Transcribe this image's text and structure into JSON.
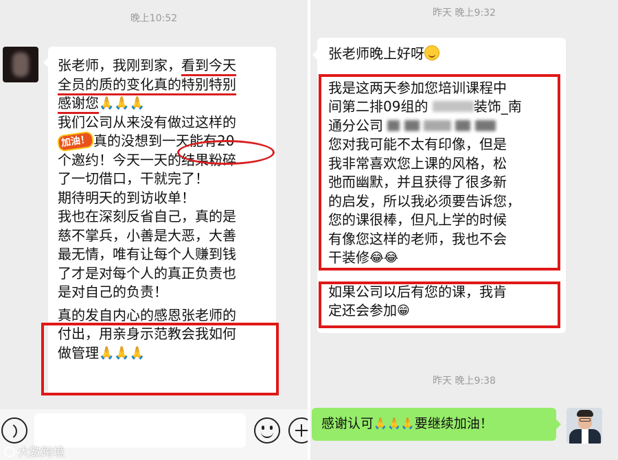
{
  "left_chat": {
    "timestamp": "晚上10:52",
    "message_lines": [
      "张老师，我刚到家，",
      "看到今天",
      "全员的质的变化真的",
      "特别特别",
      "感谢您",
      "我们公司从来没有做过这样的",
      "真的没想到",
      "一天能有20",
      "个邀约！今天一天的结果粉碎",
      "了一切借口，干就完了！",
      "期待明天的到访收单！",
      "我也在深刻反省自己，真的是",
      "慈不掌兵，小善是大恶，大善",
      "最无情，唯有让每个人赚到钱",
      "了才是对每个人的真正负责也",
      "是对自己的负责！",
      "真的发自内心的感恩张老师的",
      "付出，用亲身示范教会我如何",
      "做管理"
    ],
    "sticker_label": "加油！",
    "pray_emoji": "🙏🙏🙏",
    "input_placeholder": "",
    "watermark": "大數跨境"
  },
  "right_chat": {
    "timestamp_top": "昨天 晚上9:32",
    "greeting": "张老师晚上好呀",
    "message_lines": [
      "我是这两天参加您培训课程中",
      "间第二排09组的",
      "装饰_南",
      "通分公司",
      "您对我可能不太有印像，但是",
      "我非常喜欢您上课的风格，松",
      "弛而幽默，并且获得了很多新",
      "的启发，所以我必须要告诉您，",
      "您的课很棒，但凡上学的时候",
      "有像您这样的老师，我也不会",
      "干装修"
    ],
    "laugh_emoji": "😂😂",
    "followup_lines": [
      "如果公司以后有您的课，我肯",
      "定还会参加"
    ],
    "grin_emoji": "😁",
    "timestamp_bottom": "昨天 晚上9:38",
    "sent_message_prefix": "感谢认可",
    "sent_message_suffix": "要继续加油！",
    "sent_emoji": "🙏🙏🙏"
  },
  "colors": {
    "chat_background": "#ededed",
    "incoming_bubble": "#ffffff",
    "outgoing_bubble": "#95ec69",
    "highlight_red": "#e01818"
  }
}
